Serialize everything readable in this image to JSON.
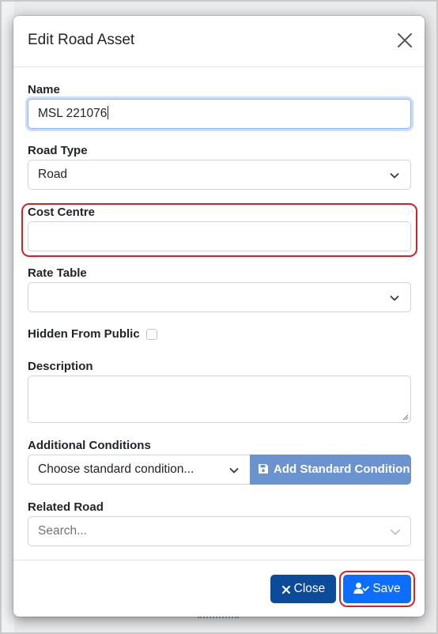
{
  "dialog": {
    "title": "Edit Road Asset"
  },
  "fields": {
    "name": {
      "label": "Name",
      "value": "MSL 221076"
    },
    "road_type": {
      "label": "Road Type",
      "value": "Road"
    },
    "cost_centre": {
      "label": "Cost Centre",
      "value": ""
    },
    "rate_table": {
      "label": "Rate Table",
      "value": ""
    },
    "hidden_from_public": {
      "label": "Hidden From Public",
      "checked": false
    },
    "description": {
      "label": "Description",
      "value": ""
    },
    "additional_conditions": {
      "label": "Additional Conditions",
      "placeholder": "Choose standard condition...",
      "add_button_label": "Add Standard Condition"
    },
    "related_road": {
      "label": "Related Road",
      "placeholder": "Search..."
    }
  },
  "footer": {
    "close_label": "Close",
    "save_label": "Save"
  },
  "colors": {
    "primary": "#0d6efd",
    "close_button": "#0c4a9a",
    "add_button": "#6b93cf",
    "annotation": "#d9202a"
  },
  "icons": {
    "close": "close-icon",
    "chevron": "chevron-down-icon",
    "save_disk": "floppy-disk-icon",
    "user_check": "user-check-icon",
    "times": "times-icon"
  }
}
